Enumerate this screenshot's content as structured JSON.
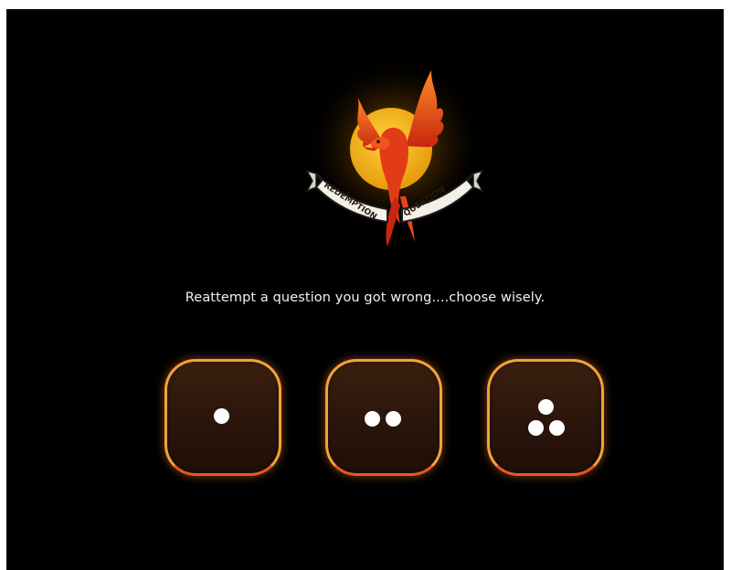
{
  "logo": {
    "banner_left": "REDEMPTION",
    "banner_right": "QUESTION",
    "icon": "phoenix-icon"
  },
  "prompt_text": "Reattempt a question you got wrong....choose wisely.",
  "choices": [
    {
      "icon": "one-dot-icon",
      "pips": 1
    },
    {
      "icon": "two-dots-icon",
      "pips": 2
    },
    {
      "icon": "three-dots-icon",
      "pips": 3
    }
  ],
  "colors": {
    "background": "#000000",
    "sun": "#f2b21b",
    "phoenix": "#e8431d",
    "button_border_top": "#f3a23a",
    "button_border_bottom": "#e7572b",
    "button_fill": "#2a150b",
    "text": "#f2f2f2"
  }
}
